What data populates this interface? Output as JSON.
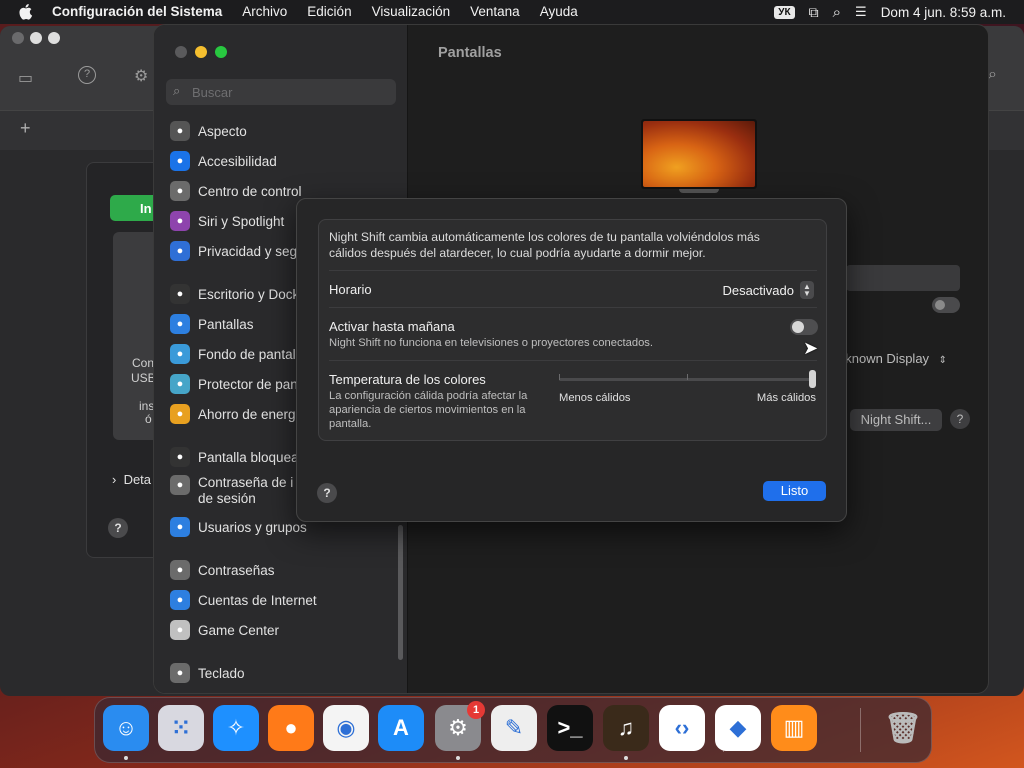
{
  "menubar": {
    "app_name": "Configuración del Sistema",
    "items": [
      "Archivo",
      "Edición",
      "Visualización",
      "Ventana",
      "Ayuda"
    ],
    "keyboard_layout": "УК",
    "datetime": "Dom 4 jun.  8:59 a.m."
  },
  "background_window": {
    "install_label": "In",
    "text_lines": [
      "Con",
      "USB",
      "ins",
      "ó"
    ],
    "details_label": "Deta",
    "help_label": "?"
  },
  "settings": {
    "search_placeholder": "Buscar",
    "content_title": "Pantallas",
    "sidebar": [
      {
        "label": "Aspecto",
        "icon": "appearance-icon",
        "color": "#555555"
      },
      {
        "label": "Accesibilidad",
        "icon": "accessibility-icon",
        "color": "#1a73e8"
      },
      {
        "label": "Centro de control",
        "icon": "control-center-icon",
        "color": "#6b6b6b"
      },
      {
        "label": "Siri y Spotlight",
        "icon": "siri-icon",
        "color": "#8e44ad"
      },
      {
        "label": "Privacidad y seg",
        "icon": "privacy-hand-icon",
        "color": "#2f6fd6"
      },
      {
        "label": "Escritorio y Dock",
        "icon": "desktop-dock-icon",
        "color": "#333333"
      },
      {
        "label": "Pantallas",
        "icon": "displays-icon",
        "color": "#2d7fe0"
      },
      {
        "label": "Fondo de pantal",
        "icon": "wallpaper-icon",
        "color": "#3a9ad9"
      },
      {
        "label": "Protector de pan",
        "icon": "screensaver-icon",
        "color": "#46a5c8"
      },
      {
        "label": "Ahorro de energ",
        "icon": "energy-icon",
        "color": "#e8a020"
      },
      {
        "label": "Pantalla bloquea",
        "icon": "lock-screen-icon",
        "color": "#333333"
      },
      {
        "label": "Contraseña de i",
        "label2": "de sesión",
        "icon": "login-password-icon",
        "color": "#6b6b6b"
      },
      {
        "label": "Usuarios y grupos",
        "icon": "users-groups-icon",
        "color": "#2d7fe0"
      },
      {
        "label": "Contraseñas",
        "icon": "passwords-icon",
        "color": "#6b6b6b"
      },
      {
        "label": "Cuentas de Internet",
        "icon": "internet-accounts-icon",
        "color": "#2d7fe0"
      },
      {
        "label": "Game Center",
        "icon": "game-center-icon",
        "color": "#c0c0c0"
      },
      {
        "label": "Teclado",
        "icon": "keyboard-icon",
        "color": "#6b6b6b"
      }
    ],
    "bg_display_select": "nknown Display",
    "bg_nightshift_button": "Night Shift...",
    "bg_help": "?"
  },
  "night_shift": {
    "description": "Night Shift cambia automáticamente los colores de tu pantalla volviéndolos más cálidos después del atardecer, lo cual podría ayudarte a dormir mejor.",
    "schedule_label": "Horario",
    "schedule_value": "Desactivado",
    "until_tomorrow_label": "Activar hasta mañana",
    "until_tomorrow_sub": "Night Shift no funciona en televisiones o proyectores conectados.",
    "until_tomorrow_on": false,
    "temperature_label": "Temperatura de los colores",
    "temperature_sub": "La configuración cálida podría afectar la apariencia de ciertos movimientos en la pantalla.",
    "temperature_min_label": "Menos cálidos",
    "temperature_max_label": "Más cálidos",
    "temperature_value": 1.0,
    "help": "?",
    "done_button": "Listo"
  },
  "dock": {
    "apps": [
      {
        "name": "finder-icon",
        "glyph": "☺",
        "bg": "#2a8cf0",
        "running": true
      },
      {
        "name": "launchpad-icon",
        "glyph": "⁙",
        "bg": "#d8d8e0",
        "running": false
      },
      {
        "name": "safari-icon",
        "glyph": "✧",
        "bg": "#1e90ff",
        "running": false
      },
      {
        "name": "firefox-icon",
        "glyph": "●",
        "bg": "#ff7a18",
        "running": false
      },
      {
        "name": "chrome-icon",
        "glyph": "◉",
        "bg": "#f4f4f4",
        "running": false
      },
      {
        "name": "app-store-icon",
        "glyph": "A",
        "bg": "#1d8cf8",
        "running": false
      },
      {
        "name": "system-settings-icon",
        "glyph": "⚙",
        "bg": "#8a8a8e",
        "running": true,
        "badge": "1"
      },
      {
        "name": "textedit-icon",
        "glyph": "✎",
        "bg": "#eeeeee",
        "running": false
      },
      {
        "name": "terminal-icon",
        "glyph": ">_",
        "bg": "#111111",
        "running": false
      },
      {
        "name": "garageband-icon",
        "glyph": "♫",
        "bg": "#3a2a1a",
        "running": true
      },
      {
        "name": "vscode-icon",
        "glyph": "‹›",
        "bg": "#ffffff",
        "running": false
      },
      {
        "name": "visual-studio-icon",
        "glyph": "◆",
        "bg": "#ffffff",
        "running": false
      },
      {
        "name": "books-icon",
        "glyph": "▥",
        "bg": "#ff8c1a",
        "running": false
      },
      {
        "name": "trash-icon",
        "glyph": "🗑",
        "bg": "transparent",
        "running": false
      }
    ]
  }
}
